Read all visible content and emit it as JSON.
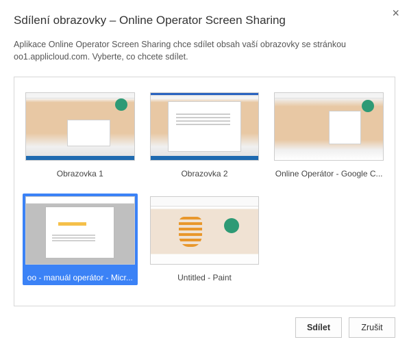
{
  "dialog": {
    "title": "Sdílení obrazovky – Online Operator Screen Sharing",
    "description": "Aplikace Online Operator Screen Sharing chce sdílet obsah vaší obrazovky se stránkou oo1.applicloud.com. Vyberte, co chcete sdílet.",
    "close_glyph": "×"
  },
  "items": [
    {
      "id": "obrazovka-1",
      "label": "Obrazovka 1",
      "thumb_kind": "ob1",
      "selected": false
    },
    {
      "id": "obrazovka-2",
      "label": "Obrazovka 2",
      "thumb_kind": "ob2",
      "selected": false
    },
    {
      "id": "online-operator-chrome",
      "label": "Online Operátor - Google C...",
      "thumb_kind": "gc",
      "selected": false
    },
    {
      "id": "oo-manual-word",
      "label": "oo - manuál operátor - Micr...",
      "thumb_kind": "word",
      "selected": true
    },
    {
      "id": "untitled-paint",
      "label": "Untitled - Paint",
      "thumb_kind": "paint",
      "selected": false
    }
  ],
  "buttons": {
    "share": "Sdílet",
    "cancel": "Zrušit"
  }
}
